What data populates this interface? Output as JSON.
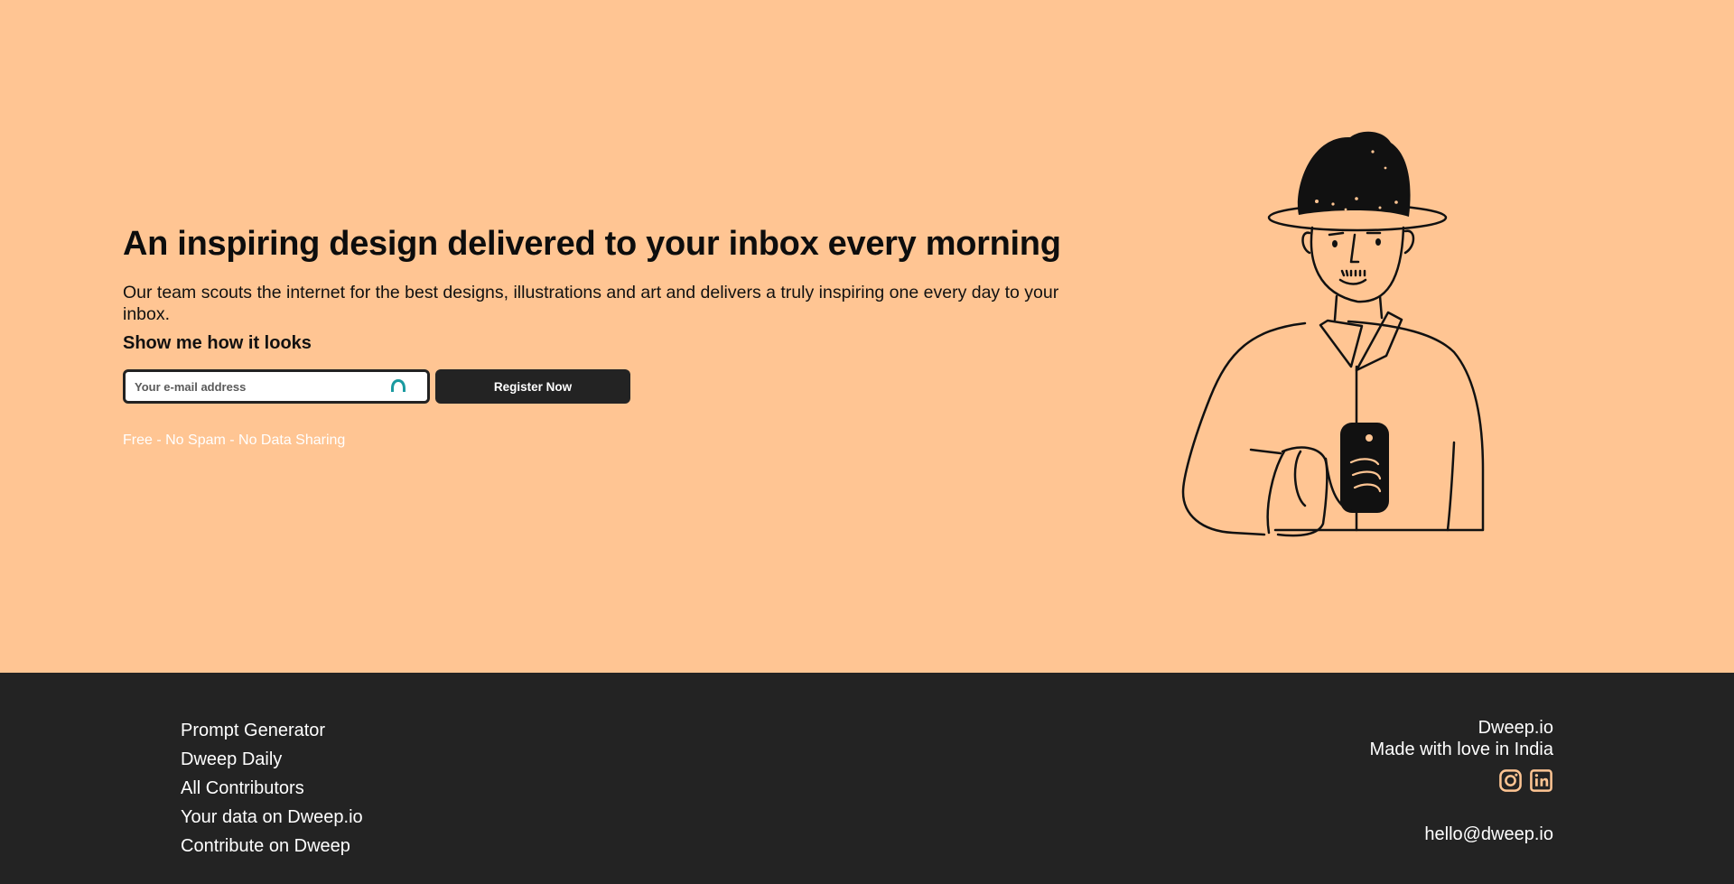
{
  "hero": {
    "title": "An inspiring design delivered to your inbox every morning",
    "description": "Our team scouts the internet for the best designs, illustrations and art and delivers a truly inspiring one every day to your inbox.",
    "subheading": "Show me how it looks",
    "email_placeholder": "Your e-mail address",
    "email_value": "",
    "register_label": "Register Now",
    "note": "Free - No Spam - No Data Sharing",
    "illustration": "man-in-hat-holding-phone"
  },
  "footer": {
    "links": [
      {
        "label": "Prompt Generator"
      },
      {
        "label": "Dweep Daily"
      },
      {
        "label": "All Contributors"
      },
      {
        "label": "Your data on Dweep.io"
      },
      {
        "label": "Contribute on Dweep"
      }
    ],
    "brand": "Dweep.io",
    "tagline": "Made with love in India",
    "socials": [
      {
        "icon": "instagram-icon"
      },
      {
        "icon": "linkedin-icon"
      }
    ],
    "email": "hello@dweep.io"
  },
  "colors": {
    "hero_bg": "#ffc593",
    "footer_bg": "#232323",
    "social_accent": "#ffc593",
    "password_manager_icon": "#1a9aa0"
  }
}
